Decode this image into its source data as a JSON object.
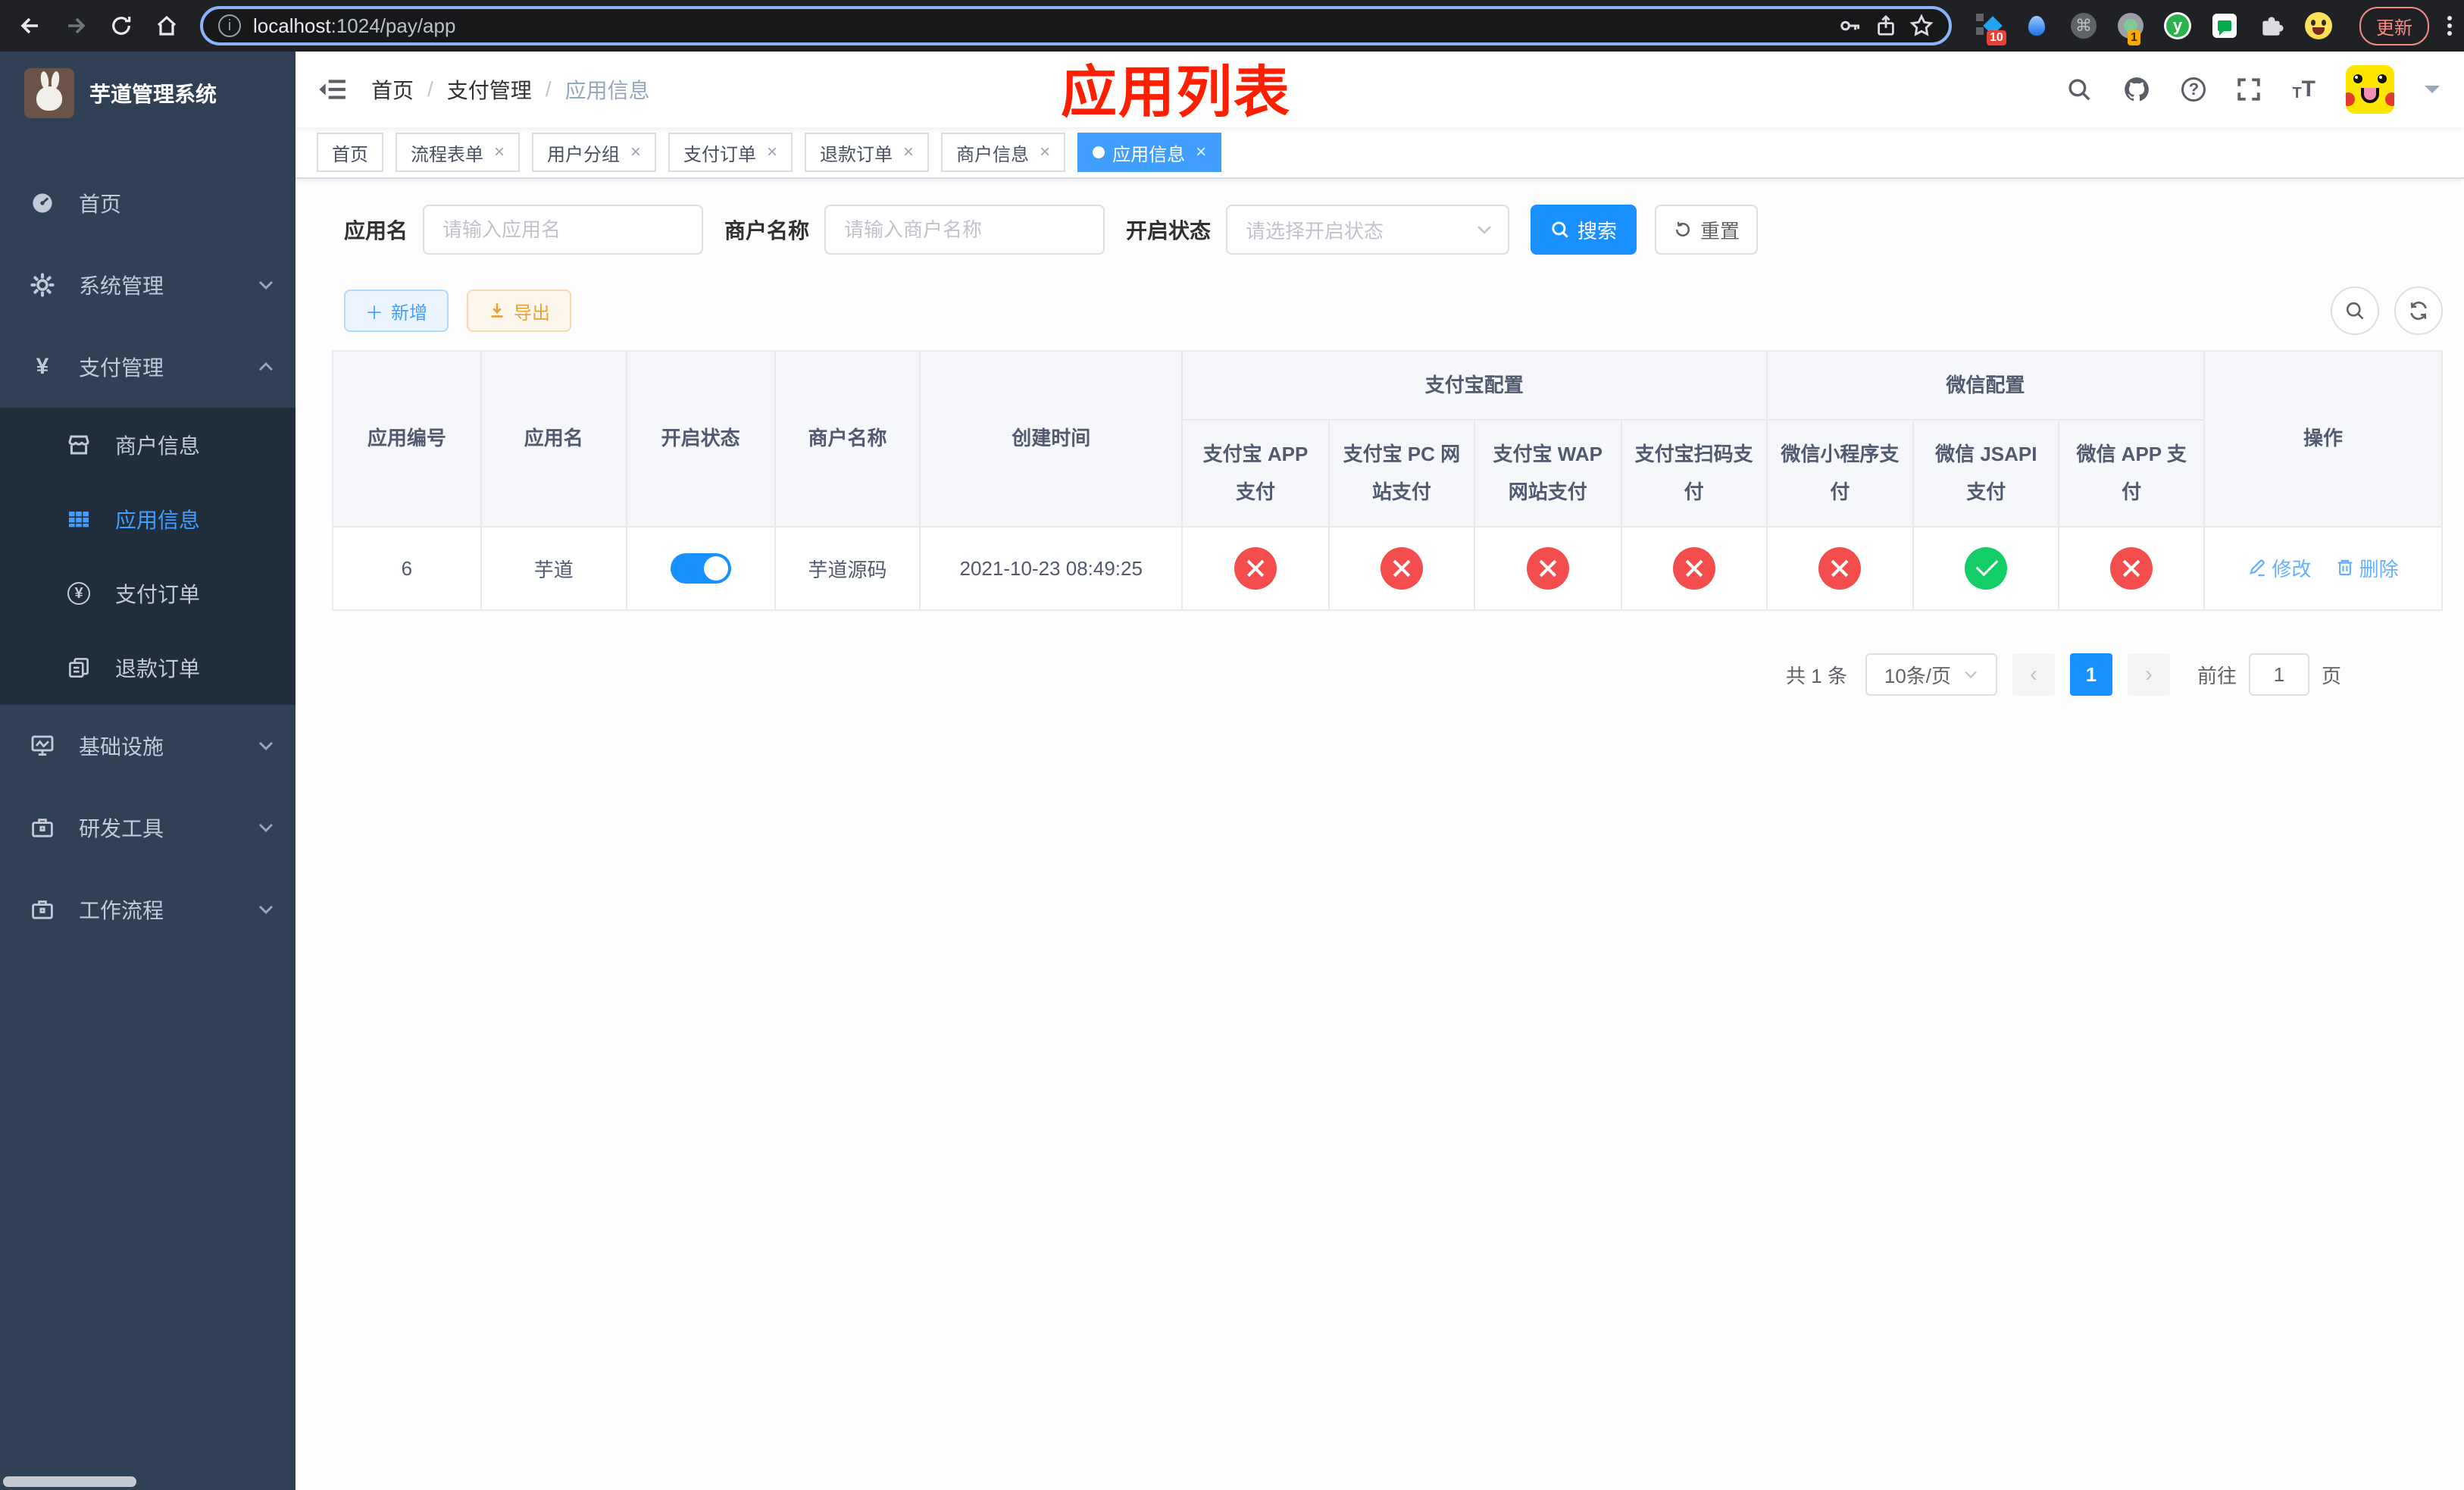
{
  "browser": {
    "url": {
      "host": "localhost",
      "path": ":1024/pay/app"
    },
    "update_button": "更新",
    "extensions": {
      "badge_a": "10",
      "badge_b": "1",
      "logo_letter": "y"
    }
  },
  "sidebar": {
    "logo_title": "芋道管理系统",
    "menu": [
      {
        "label": "首页"
      },
      {
        "label": "系统管理"
      },
      {
        "label": "支付管理"
      },
      {
        "label": "基础设施"
      },
      {
        "label": "研发工具"
      },
      {
        "label": "工作流程"
      }
    ],
    "submenu": [
      {
        "label": "商户信息"
      },
      {
        "label": "应用信息"
      },
      {
        "label": "支付订单"
      },
      {
        "label": "退款订单"
      }
    ]
  },
  "navbar": {
    "breadcrumb": [
      {
        "label": "首页"
      },
      {
        "label": "支付管理"
      },
      {
        "label": "应用信息"
      }
    ]
  },
  "overlay_title": "应用列表",
  "tags": [
    {
      "label": "首页",
      "closable": false,
      "active": false
    },
    {
      "label": "流程表单",
      "closable": true,
      "active": false
    },
    {
      "label": "用户分组",
      "closable": true,
      "active": false
    },
    {
      "label": "支付订单",
      "closable": true,
      "active": false
    },
    {
      "label": "退款订单",
      "closable": true,
      "active": false
    },
    {
      "label": "商户信息",
      "closable": true,
      "active": false
    },
    {
      "label": "应用信息",
      "closable": true,
      "active": true
    }
  ],
  "filters": {
    "app_name_label": "应用名",
    "app_name_placeholder": "请输入应用名",
    "merchant_label": "商户名称",
    "merchant_placeholder": "请输入商户名称",
    "status_label": "开启状态",
    "status_placeholder": "请选择开启状态",
    "search_button": "搜索",
    "reset_button": "重置"
  },
  "toolbar": {
    "add_button": "新增",
    "export_button": "导出"
  },
  "table": {
    "columns": [
      "应用编号",
      "应用名",
      "开启状态",
      "商户名称",
      "创建时间"
    ],
    "alipay_group": "支付宝配置",
    "alipay_columns": [
      "支付宝 APP 支付",
      "支付宝 PC 网站支付",
      "支付宝 WAP 网站支付",
      "支付宝扫码支付"
    ],
    "wechat_group": "微信配置",
    "wechat_columns": [
      "微信小程序支付",
      "微信 JSAPI 支付",
      "微信 APP 支付"
    ],
    "action_column": "操作",
    "row": {
      "id": "6",
      "name": "芋道",
      "enabled": true,
      "merchant": "芋道源码",
      "created": "2021-10-23 08:49:25",
      "statuses": [
        "no",
        "no",
        "no",
        "no",
        "no",
        "yes",
        "no"
      ],
      "edit_link": "修改",
      "delete_link": "删除"
    }
  },
  "pagination": {
    "total": "共 1 条",
    "page_size": "10条/页",
    "current_page": "1",
    "goto_label": "前往",
    "goto_value": "1",
    "goto_unit": "页"
  }
}
